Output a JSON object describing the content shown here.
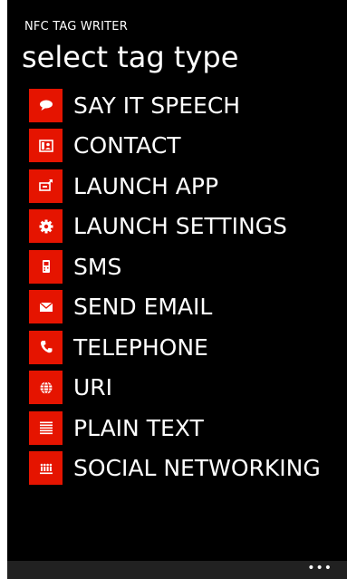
{
  "app": {
    "title": "NFC TAG WRITER",
    "page_title": "select tag type",
    "accent": "#e51400"
  },
  "tag_types": [
    {
      "label": "SAY IT SPEECH",
      "icon": "speech-bubble-icon"
    },
    {
      "label": "CONTACT",
      "icon": "contact-card-icon"
    },
    {
      "label": "LAUNCH APP",
      "icon": "launch-app-icon"
    },
    {
      "label": "LAUNCH SETTINGS",
      "icon": "gear-icon"
    },
    {
      "label": "SMS",
      "icon": "sms-phone-icon"
    },
    {
      "label": "SEND EMAIL",
      "icon": "envelope-icon"
    },
    {
      "label": "TELEPHONE",
      "icon": "phone-handset-icon"
    },
    {
      "label": "URI",
      "icon": "globe-icon"
    },
    {
      "label": "PLAIN TEXT",
      "icon": "text-lines-icon"
    },
    {
      "label": "SOCIAL NETWORKING",
      "icon": "people-icon"
    }
  ],
  "app_bar": {
    "more": "•••"
  }
}
